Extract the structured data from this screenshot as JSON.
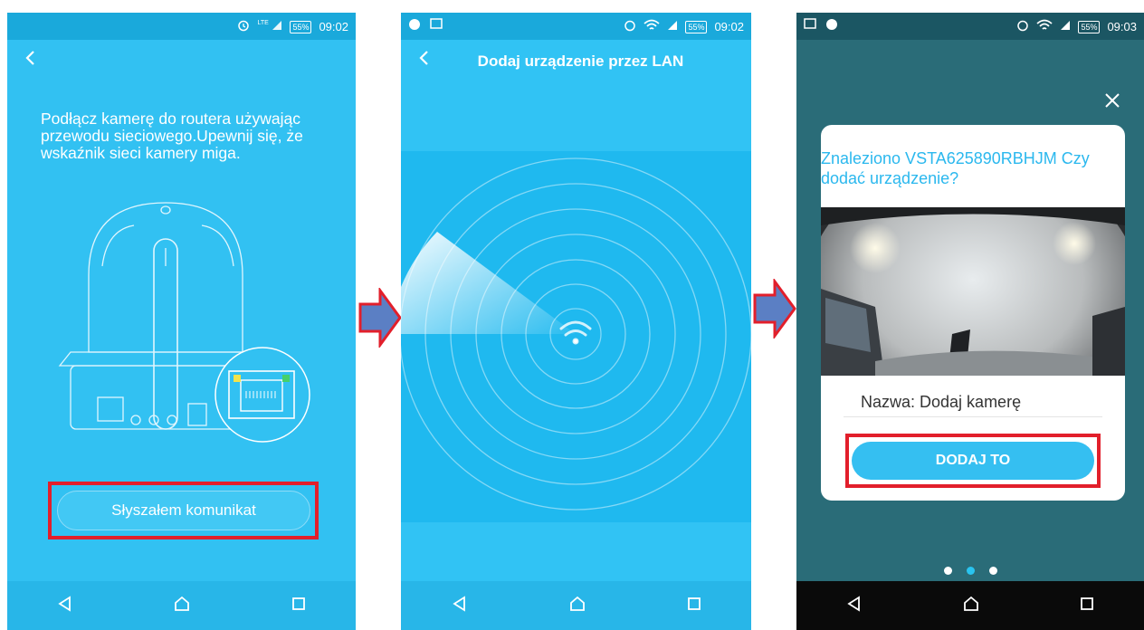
{
  "colors": {
    "accent": "#32c1f2",
    "highlight": "#e21f2b",
    "arrow_fill": "#5b7fc4"
  },
  "panel1": {
    "status": {
      "time": "09:02",
      "battery": "55%",
      "network": "LTE"
    },
    "instruction": "Podłącz kamerę do routera używając przewodu sieciowego.Upewnij się, że wskaźnik sieci kamery miga.",
    "button_label": "Słyszałem komunikat"
  },
  "panel2": {
    "status": {
      "time": "09:02",
      "battery": "55%"
    },
    "title": "Dodaj urządzenie przez LAN"
  },
  "panel3": {
    "status": {
      "time": "09:03",
      "battery": "55%"
    },
    "question": "Znaleziono VSTA625890RBHJM Czy dodać urządzenie?",
    "name_label": "Nazwa: Dodaj kamerę",
    "add_button": "DODAJ TO",
    "page_dots": {
      "count": 3,
      "active": 2
    }
  },
  "nav_icons": [
    "back-triangle-icon",
    "home-icon",
    "recents-icon"
  ]
}
